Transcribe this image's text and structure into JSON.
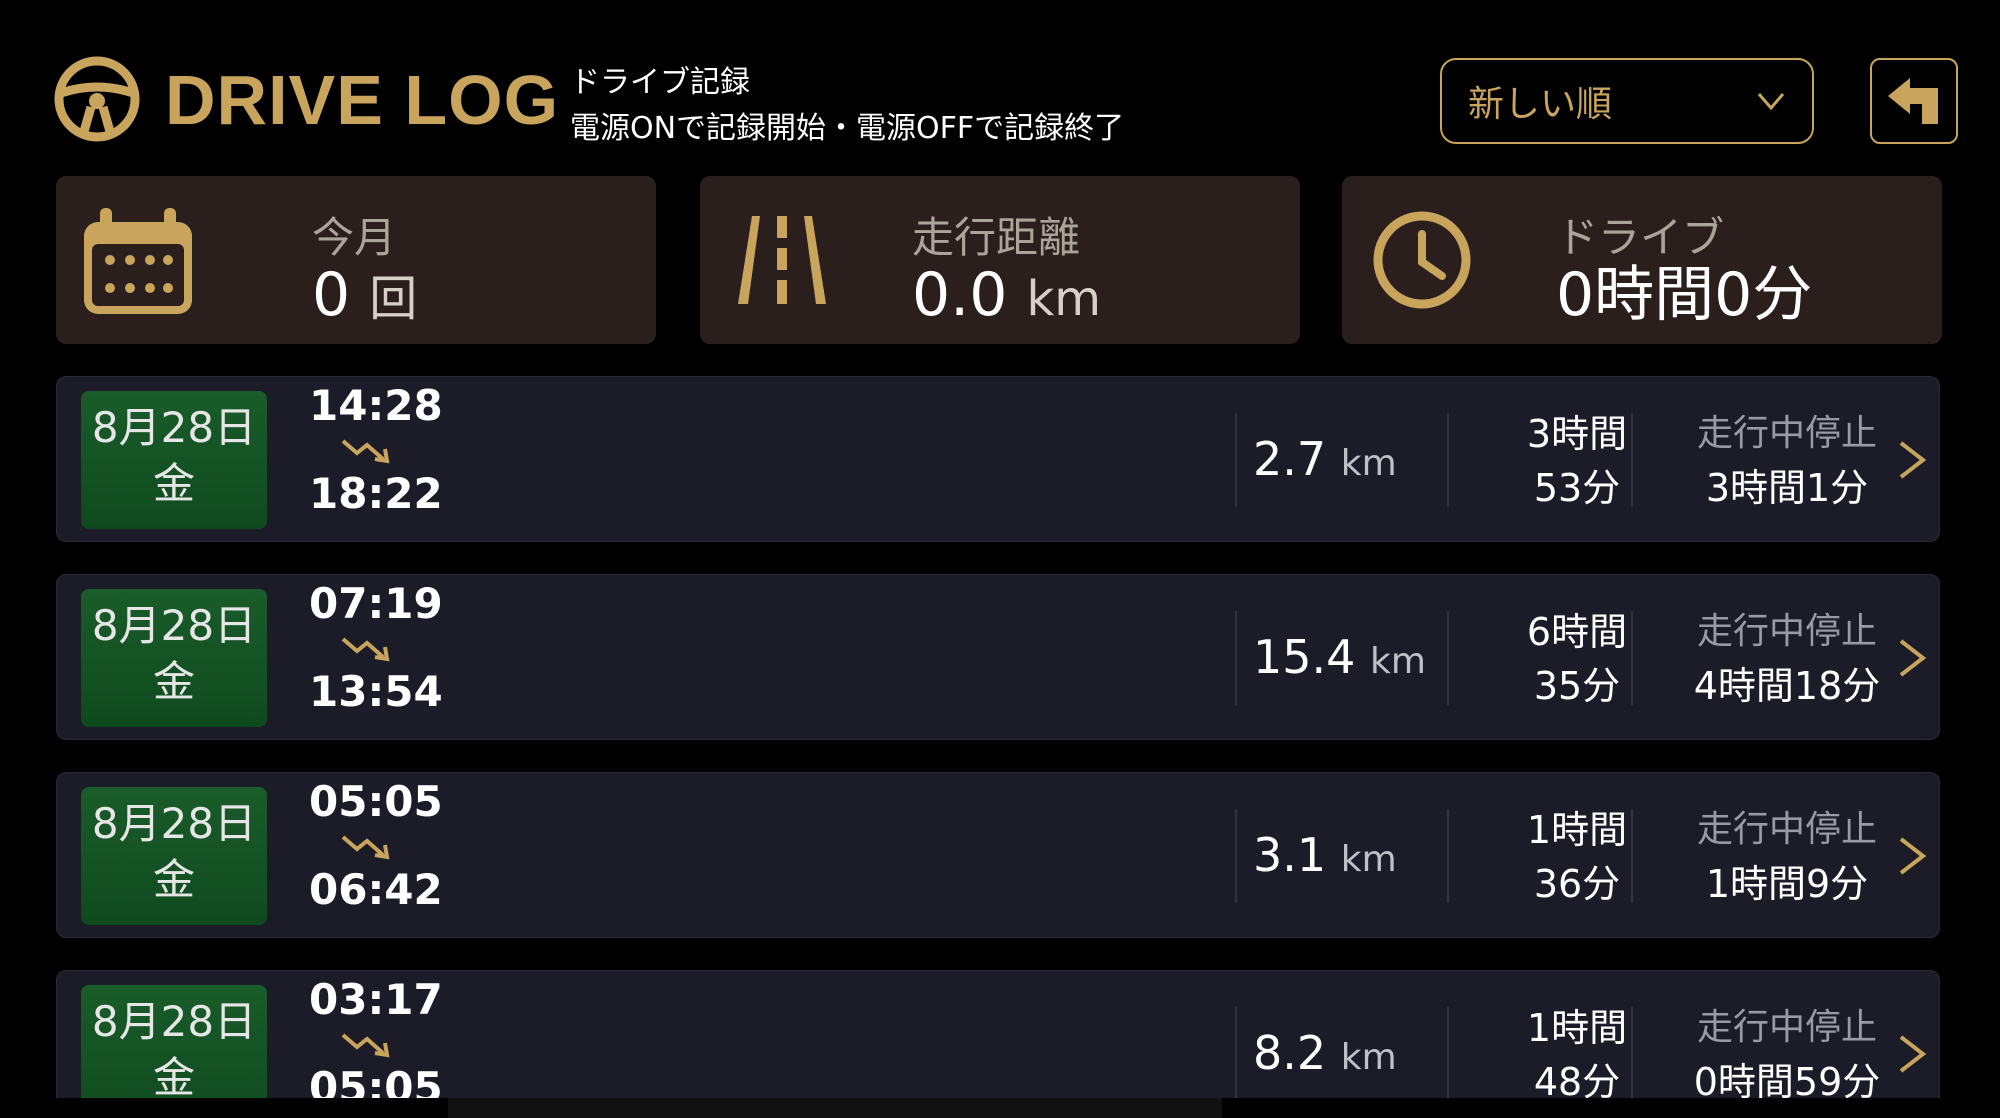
{
  "header": {
    "app_title": "DRIVE LOG",
    "subtitle_line1": "ドライブ記録",
    "subtitle_line2": "電源ONで記録開始・電源OFFで記録終了",
    "sort_value": "新しい順"
  },
  "stats": {
    "month": {
      "label": "今月",
      "value": "0",
      "unit": "回"
    },
    "distance": {
      "label": "走行距離",
      "value": "0.0",
      "unit": "km"
    },
    "drive_time": {
      "label": "ドライブ",
      "value": "0時間0分"
    }
  },
  "logs": [
    {
      "date": "8月28日",
      "weekday": "金",
      "start": "14:28",
      "end": "18:22",
      "distance": "2.7",
      "distance_unit": "km",
      "duration_h": "3時間",
      "duration_m": "53分",
      "stop_label": "走行中停止",
      "stop_value": "3時間1分"
    },
    {
      "date": "8月28日",
      "weekday": "金",
      "start": "07:19",
      "end": "13:54",
      "distance": "15.4",
      "distance_unit": "km",
      "duration_h": "6時間",
      "duration_m": "35分",
      "stop_label": "走行中停止",
      "stop_value": "4時間18分"
    },
    {
      "date": "8月28日",
      "weekday": "金",
      "start": "05:05",
      "end": "06:42",
      "distance": "3.1",
      "distance_unit": "km",
      "duration_h": "1時間",
      "duration_m": "36分",
      "stop_label": "走行中停止",
      "stop_value": "1時間9分"
    },
    {
      "date": "8月28日",
      "weekday": "金",
      "start": "03:17",
      "end": "05:05",
      "distance": "8.2",
      "distance_unit": "km",
      "duration_h": "1時間",
      "duration_m": "48分",
      "stop_label": "走行中停止",
      "stop_value": "0時間59分"
    }
  ],
  "colors": {
    "accent_gold": "#c9a45c",
    "card_bg": "#2a1f1d",
    "row_bg": "#1c1c28",
    "date_green": "#1a5c2a"
  },
  "icons": {
    "logo": "steering-wheel-icon",
    "month": "calendar-icon",
    "distance": "road-icon",
    "drive": "clock-icon",
    "back": "back-arrow-icon",
    "sort": "chevron-down-icon",
    "row": "chevron-right-icon",
    "trip": "trip-arrow-icon"
  }
}
